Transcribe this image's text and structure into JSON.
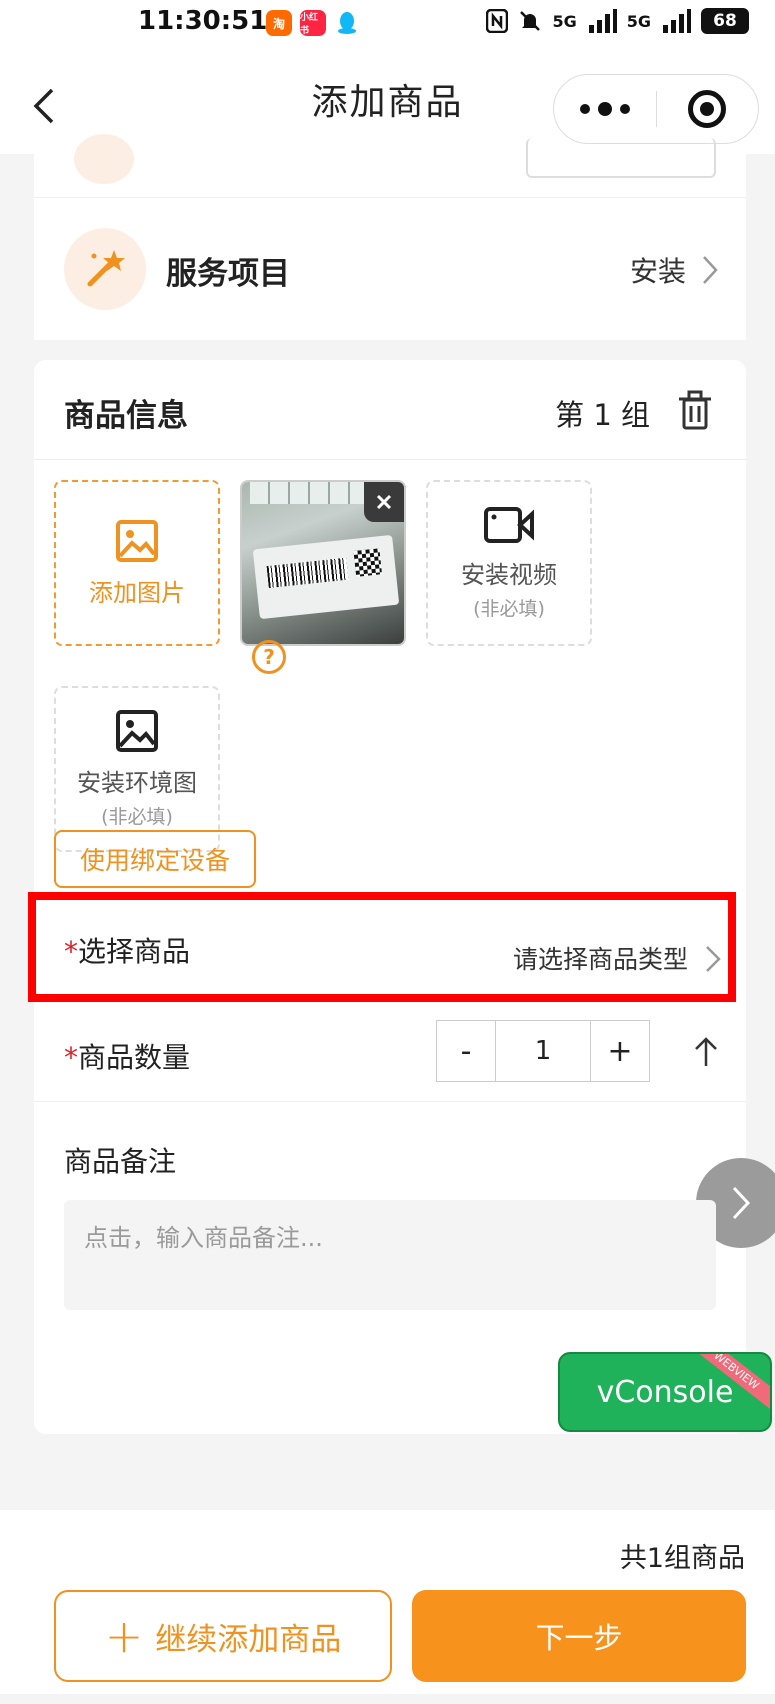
{
  "status_bar": {
    "time": "11:30:51",
    "apps": [
      {
        "icon": "taobao-icon",
        "text": "淘",
        "color": "#ff6a00"
      },
      {
        "icon": "xiaohongshu-icon",
        "text": "小红书",
        "color": "#ff2442"
      },
      {
        "icon": "qq-icon",
        "text": "",
        "color": "#12b7f5"
      }
    ],
    "network_1": "5G",
    "network_2": "5G",
    "battery": "68"
  },
  "nav": {
    "title": "添加商品",
    "back_icon": "chevron-left-icon",
    "more_icon": "more-icon",
    "close_icon": "target-icon"
  },
  "service": {
    "label": "服务项目",
    "value": "安装",
    "icon": "magic-wand-icon"
  },
  "goods": {
    "title": "商品信息",
    "group": "第 1 组",
    "delete_icon": "trash-icon",
    "tiles": {
      "add_image": "添加图片",
      "install_video": "安装视频",
      "install_video_sub": "(非必填)",
      "install_env": "安装环境图",
      "install_env_sub": "(非必填)"
    },
    "help_icon": "question-icon",
    "bind_button": "使用绑定设备",
    "select_goods": {
      "required_mark": "*",
      "label": "选择商品",
      "placeholder": "请选择商品类型"
    },
    "quantity": {
      "required_mark": "*",
      "label": "商品数量",
      "minus": "-",
      "value": "1",
      "plus": "+"
    },
    "remark": {
      "label": "商品备注",
      "placeholder": "点击，输入商品备注..."
    }
  },
  "vconsole": {
    "label": "vConsole",
    "tag": "WEBVIEW"
  },
  "footer": {
    "count": "共1组商品",
    "continue_label": "继续添加商品",
    "next_label": "下一步"
  },
  "colors": {
    "accent": "#f7921d",
    "required": "#e0202a",
    "highlight_box": "#ff0000"
  }
}
